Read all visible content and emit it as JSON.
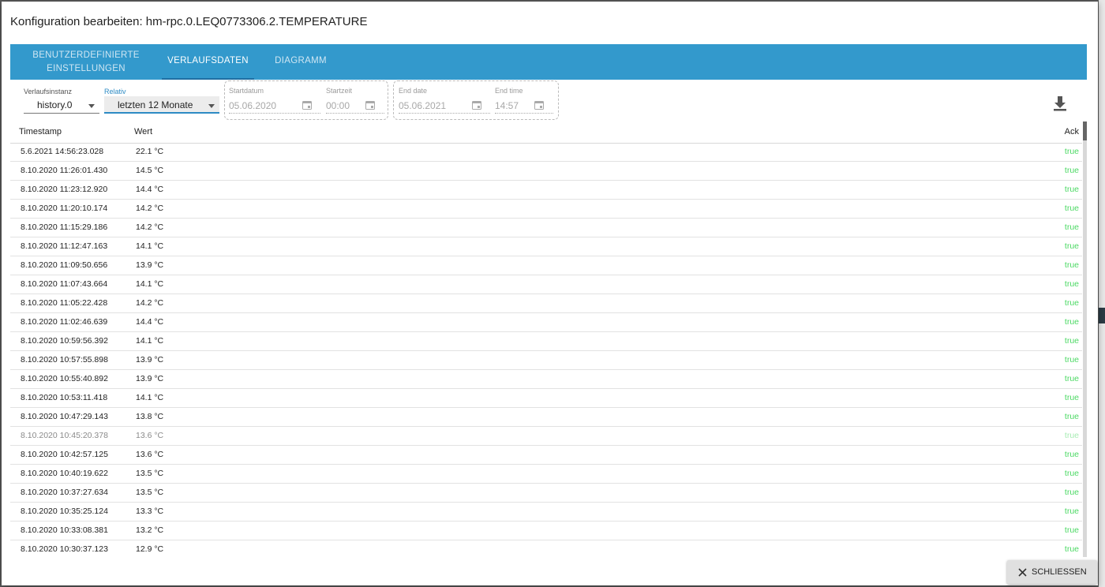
{
  "dialog": {
    "title": "Konfiguration bearbeiten: hm-rpc.0.LEQ0773306.2.TEMPERATURE"
  },
  "tabs": [
    {
      "label_line1": "BENUTZERDEFINIERTE",
      "label_line2": "EINSTELLUNGEN"
    },
    {
      "label": "VERLAUFSDATEN"
    },
    {
      "label": "DIAGRAMM"
    }
  ],
  "filters": {
    "instance_label": "Verlaufsinstanz",
    "instance_value": "history.0",
    "relative_label": "Relativ",
    "relative_value": "letzten 12 Monate",
    "start_date_label": "Startdatum",
    "start_date_value": "05.06.2020",
    "start_time_label": "Startzeit",
    "start_time_value": "00:00",
    "end_date_label": "End date",
    "end_date_value": "05.06.2021",
    "end_time_label": "End time",
    "end_time_value": "14:57"
  },
  "table": {
    "headers": {
      "timestamp": "Timestamp",
      "value": "Wert",
      "ack": "Ack"
    },
    "rows": [
      {
        "ts": "5.6.2021 14:56:23.028",
        "val": "22.1 °C",
        "ack": "true"
      },
      {
        "ts": "8.10.2020 11:26:01.430",
        "val": "14.5 °C",
        "ack": "true"
      },
      {
        "ts": "8.10.2020 11:23:12.920",
        "val": "14.4 °C",
        "ack": "true"
      },
      {
        "ts": "8.10.2020 11:20:10.174",
        "val": "14.2 °C",
        "ack": "true"
      },
      {
        "ts": "8.10.2020 11:15:29.186",
        "val": "14.2 °C",
        "ack": "true"
      },
      {
        "ts": "8.10.2020 11:12:47.163",
        "val": "14.1 °C",
        "ack": "true"
      },
      {
        "ts": "8.10.2020 11:09:50.656",
        "val": "13.9 °C",
        "ack": "true"
      },
      {
        "ts": "8.10.2020 11:07:43.664",
        "val": "14.1 °C",
        "ack": "true"
      },
      {
        "ts": "8.10.2020 11:05:22.428",
        "val": "14.2 °C",
        "ack": "true"
      },
      {
        "ts": "8.10.2020 11:02:46.639",
        "val": "14.4 °C",
        "ack": "true"
      },
      {
        "ts": "8.10.2020 10:59:56.392",
        "val": "14.1 °C",
        "ack": "true"
      },
      {
        "ts": "8.10.2020 10:57:55.898",
        "val": "13.9 °C",
        "ack": "true"
      },
      {
        "ts": "8.10.2020 10:55:40.892",
        "val": "13.9 °C",
        "ack": "true"
      },
      {
        "ts": "8.10.2020 10:53:11.418",
        "val": "14.1 °C",
        "ack": "true"
      },
      {
        "ts": "8.10.2020 10:47:29.143",
        "val": "13.8 °C",
        "ack": "true"
      },
      {
        "ts": "8.10.2020 10:45:20.378",
        "val": "13.6 °C",
        "ack": "true"
      },
      {
        "ts": "8.10.2020 10:42:57.125",
        "val": "13.6 °C",
        "ack": "true"
      },
      {
        "ts": "8.10.2020 10:40:19.622",
        "val": "13.5 °C",
        "ack": "true"
      },
      {
        "ts": "8.10.2020 10:37:27.634",
        "val": "13.5 °C",
        "ack": "true"
      },
      {
        "ts": "8.10.2020 10:35:25.124",
        "val": "13.3 °C",
        "ack": "true"
      },
      {
        "ts": "8.10.2020 10:33:08.381",
        "val": "13.2 °C",
        "ack": "true"
      },
      {
        "ts": "8.10.2020 10:30:37.123",
        "val": "12.9 °C",
        "ack": "true"
      }
    ]
  },
  "footer": {
    "close_label": "SCHLIESSEN"
  },
  "colors": {
    "tab_bar": "#3399cc",
    "ack_true": "#4cd964",
    "focus_blue": "#2d8bc4"
  },
  "icons": {
    "calendar": "calendar-icon",
    "download": "download-icon",
    "close": "close-icon",
    "dropdown": "chevron-down-icon"
  }
}
